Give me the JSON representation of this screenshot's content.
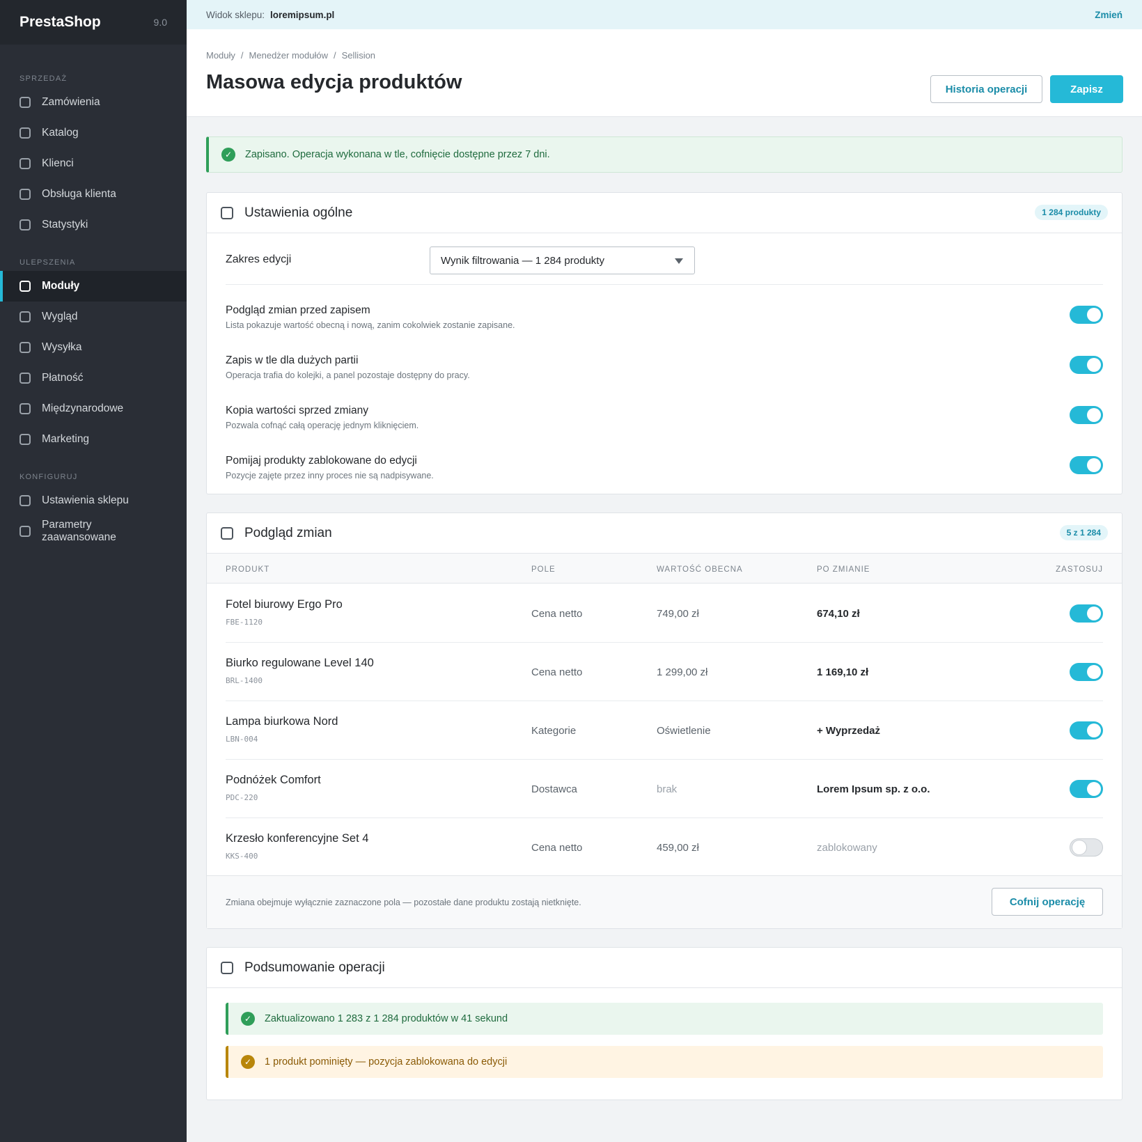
{
  "sidebar": {
    "brand": "PrestaShop",
    "version": "9.0",
    "sections": [
      {
        "label": "SPRZEDAŻ",
        "items": [
          "Zamówienia",
          "Katalog",
          "Klienci",
          "Obsługa klienta",
          "Statystyki"
        ]
      },
      {
        "label": "ULEPSZENIA",
        "items": [
          "Moduły",
          "Wygląd",
          "Wysyłka",
          "Płatność",
          "Międzynarodowe",
          "Marketing"
        ]
      },
      {
        "label": "KONFIGURUJ",
        "items": [
          "Ustawienia sklepu",
          "Parametry zaawansowane"
        ]
      }
    ],
    "active_item": "Moduły"
  },
  "topbar": {
    "label": "Widok sklepu:",
    "shop": "loremipsum.pl",
    "change": "Zmień"
  },
  "header": {
    "breadcrumb": [
      "Moduły",
      "/",
      "Menedżer modułów",
      "/",
      "Sellision"
    ],
    "title": "Masowa edycja produktów",
    "history_button": "Historia operacji",
    "save_button": "Zapisz"
  },
  "success_alert": "Zapisano. Operacja wykonana w tle, cofnięcie dostępne przez 7 dni.",
  "general": {
    "title": "Ustawienia ogólne",
    "badge": "1 284 produkty",
    "scope_label": "Zakres edycji",
    "scope_value": "Wynik filtrowania — 1 284 produkty",
    "settings": [
      {
        "title": "Podgląd zmian przed zapisem",
        "desc": "Lista pokazuje wartość obecną i nową, zanim cokolwiek zostanie zapisane.",
        "on": true
      },
      {
        "title": "Zapis w tle dla dużych partii",
        "desc": "Operacja trafia do kolejki, a panel pozostaje dostępny do pracy.",
        "on": true
      },
      {
        "title": "Kopia wartości sprzed zmiany",
        "desc": "Pozwala cofnąć całą operację jednym kliknięciem.",
        "on": true
      },
      {
        "title": "Pomijaj produkty zablokowane do edycji",
        "desc": "Pozycje zajęte przez inny proces nie są nadpisywane.",
        "on": true
      }
    ]
  },
  "preview": {
    "title": "Podgląd zmian",
    "badge": "5 z 1 284",
    "columns": {
      "product": "PRODUKT",
      "field": "POLE",
      "current": "WARTOŚĆ OBECNA",
      "after": "PO ZMIANIE",
      "apply": "ZASTOSUJ"
    },
    "rows": [
      {
        "name": "Fotel biurowy Ergo Pro",
        "sku": "FBE-1120",
        "field": "Cena netto",
        "current": "749,00 zł",
        "after": "674,10 zł",
        "apply": true
      },
      {
        "name": "Biurko regulowane Level 140",
        "sku": "BRL-1400",
        "field": "Cena netto",
        "current": "1 299,00 zł",
        "after": "1 169,10 zł",
        "apply": true
      },
      {
        "name": "Lampa biurkowa Nord",
        "sku": "LBN-004",
        "field": "Kategorie",
        "current": "Oświetlenie",
        "after": "+ Wyprzedaż",
        "apply": true
      },
      {
        "name": "Podnóżek Comfort",
        "sku": "PDC-220",
        "field": "Dostawca",
        "current": "brak",
        "after": "Lorem Ipsum sp. z o.o.",
        "apply": true
      },
      {
        "name": "Krzesło konferencyjne Set 4",
        "sku": "KKS-400",
        "field": "Cena netto",
        "current": "459,00 zł",
        "after": "zablokowany",
        "apply": false
      }
    ],
    "footer_note": "Zmiana obejmuje wyłącznie zaznaczone pola — pozostałe dane produktu zostają nietknięte.",
    "undo_button": "Cofnij operację"
  },
  "summary": {
    "title": "Podsumowanie operacji",
    "success": "Zaktualizowano 1 283 z 1 284 produktów w 41 sekund",
    "warning": "1 produkt pominięty — pozycja zablokowana do edycji"
  },
  "colors": {
    "accent": "#25b9d7",
    "sidebar": "#2a2e36",
    "success": "#2f9e59",
    "warning": "#b8860b"
  }
}
